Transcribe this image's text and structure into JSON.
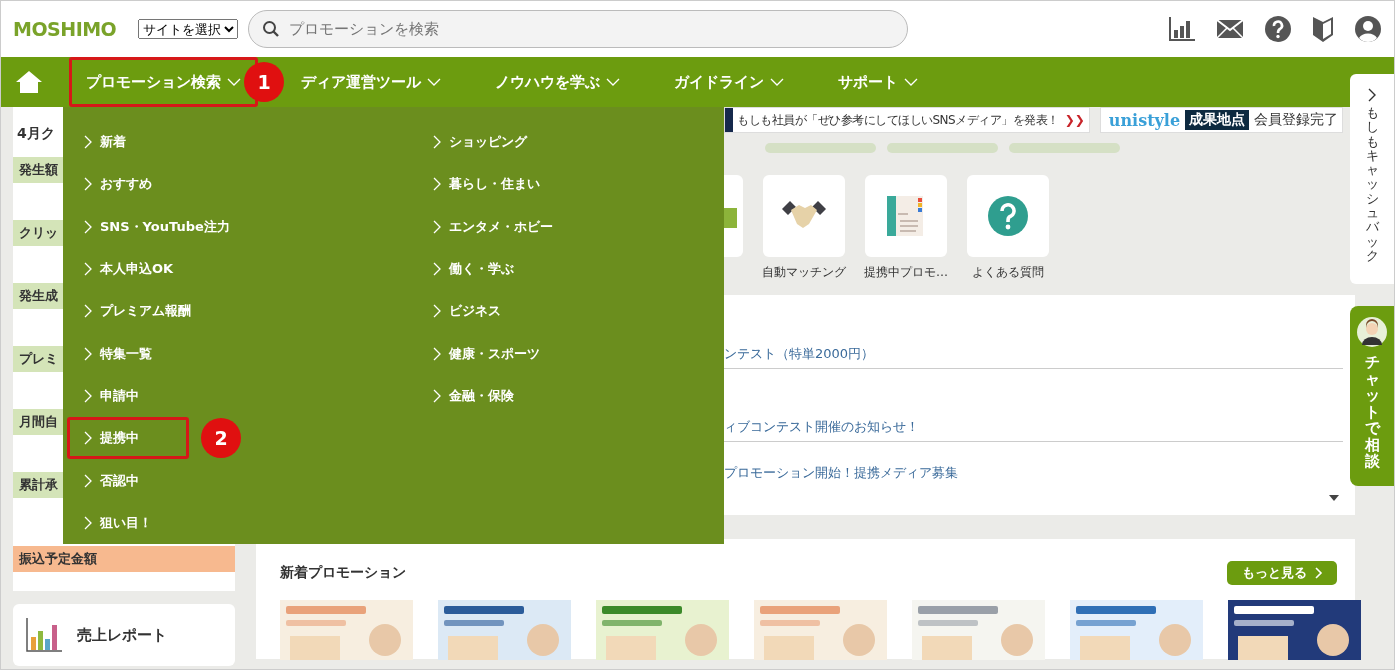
{
  "header": {
    "logo": "MOSHIMO",
    "site_select": "サイトを選択",
    "search": {
      "placeholder": "プロモーションを検索"
    }
  },
  "nav": [
    {
      "label": "プロモーション検索",
      "highlighted": true,
      "badge": "1"
    },
    {
      "label": "ディア運営ツール",
      "highlighted": false
    },
    {
      "label": "ノウハウを学ぶ",
      "highlighted": false
    },
    {
      "label": "ガイドライン",
      "highlighted": false
    },
    {
      "label": "サポート",
      "highlighted": false
    }
  ],
  "dropdown": {
    "columns": [
      [
        {
          "label": "新着",
          "highlighted": false
        },
        {
          "label": "おすすめ",
          "highlighted": false
        },
        {
          "label": "SNS・YouTube注力",
          "highlighted": false
        },
        {
          "label": "本人申込OK",
          "highlighted": false
        },
        {
          "label": "プレミアム報酬",
          "highlighted": false
        },
        {
          "label": "特集一覧",
          "highlighted": false
        },
        {
          "label": "申請中",
          "highlighted": false
        },
        {
          "label": "提携中",
          "highlighted": true,
          "badge": "2"
        },
        {
          "label": "否認中",
          "highlighted": false
        },
        {
          "label": "狙い目！",
          "highlighted": false
        }
      ],
      [
        {
          "label": "ショッピング",
          "highlighted": false
        },
        {
          "label": "暮らし・住まい",
          "highlighted": false
        },
        {
          "label": "エンタメ・ホビー",
          "highlighted": false
        },
        {
          "label": "働く・学ぶ",
          "highlighted": false
        },
        {
          "label": "ビジネス",
          "highlighted": false
        },
        {
          "label": "健康・スポーツ",
          "highlighted": false
        },
        {
          "label": "金融・保険",
          "highlighted": false
        }
      ]
    ]
  },
  "sidebar": {
    "labels": [
      {
        "text": "4月ク",
        "kind": "title"
      },
      {
        "text": "発生額",
        "kind": "metric"
      },
      {
        "text": "クリッ",
        "kind": "metric"
      },
      {
        "text": "発生成",
        "kind": "metric"
      },
      {
        "text": "プレミ",
        "kind": "metric"
      },
      {
        "text": "月間自",
        "kind": "metric"
      },
      {
        "text": "累計承",
        "kind": "metric"
      },
      {
        "text": "振込予定金額",
        "kind": "transfer"
      }
    ],
    "report_card": "売上レポート"
  },
  "banners": [
    {
      "kind": "announcement",
      "text": "もしも社員が「ぜひ参考にしてほしいSNSメディア」を発表！",
      "arrow": "❯❯"
    },
    {
      "kind": "brand",
      "brand": "unistyle",
      "tag": "成果地点",
      "text": "会員登録完了"
    }
  ],
  "tiles": [
    {
      "kind": "message"
    },
    {
      "kind": "handshake",
      "label": "自動マッチング"
    },
    {
      "kind": "promotion",
      "label": "提携中プロモ…"
    },
    {
      "kind": "faq",
      "label": "よくある質問"
    }
  ],
  "news": [
    "ンテスト（特単2000円）",
    "ィブコンテスト開催のお知らせ！",
    "プロモーション開始！提携メディア募集"
  ],
  "side_tabs": {
    "cashback": "もしもキャッシュバック",
    "chat": "チャットで相談"
  },
  "new_promotions": {
    "title": "新着プロモーション",
    "more_button": "もっと見る"
  }
}
